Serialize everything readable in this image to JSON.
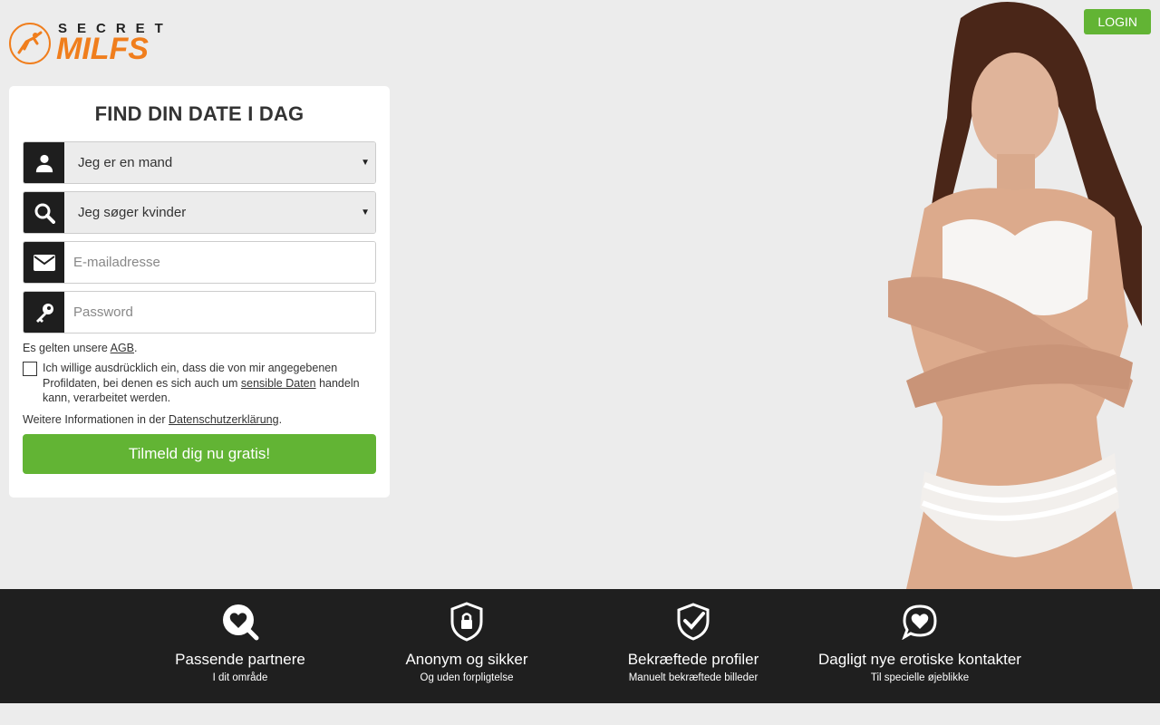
{
  "brand": {
    "logo_top": "SECRET",
    "logo_main": "MILFS",
    "accent_color": "#f07e1d"
  },
  "header": {
    "login_label": "LOGIN"
  },
  "form": {
    "title": "FIND DIN DATE I DAG",
    "gender_select": {
      "value": "Jeg er en mand",
      "icon": "user-icon"
    },
    "seeking_select": {
      "value": "Jeg søger kvinder",
      "icon": "search-icon"
    },
    "email": {
      "placeholder": "E-mailadresse",
      "icon": "envelope-icon"
    },
    "password": {
      "placeholder": "Password",
      "icon": "key-icon"
    },
    "terms_prefix": "Es gelten unsere ",
    "terms_link": "AGB",
    "terms_suffix": ".",
    "consent_prefix": "Ich willige ausdrücklich ein, dass die von mir angegebenen Profildaten, bei denen es sich auch um ",
    "consent_link": "sensible Daten",
    "consent_suffix": " handeln kann, verarbeitet werden.",
    "privacy_prefix": "Weitere Informationen in der ",
    "privacy_link": "Datenschutzerklärung",
    "privacy_suffix": ".",
    "submit_label": "Tilmeld dig nu gratis!",
    "button_color": "#62b434"
  },
  "features": [
    {
      "icon": "heart-search-icon",
      "title": "Passende partnere",
      "subtitle": "I dit område"
    },
    {
      "icon": "shield-lock-icon",
      "title": "Anonym og sikker",
      "subtitle": "Og uden forpligtelse"
    },
    {
      "icon": "shield-check-icon",
      "title": "Bekræftede profiler",
      "subtitle": "Manuelt bekræftede billeder"
    },
    {
      "icon": "chat-heart-icon",
      "title": "Dagligt nye erotiske kontakter",
      "subtitle": "Til specielle øjeblikke"
    }
  ]
}
